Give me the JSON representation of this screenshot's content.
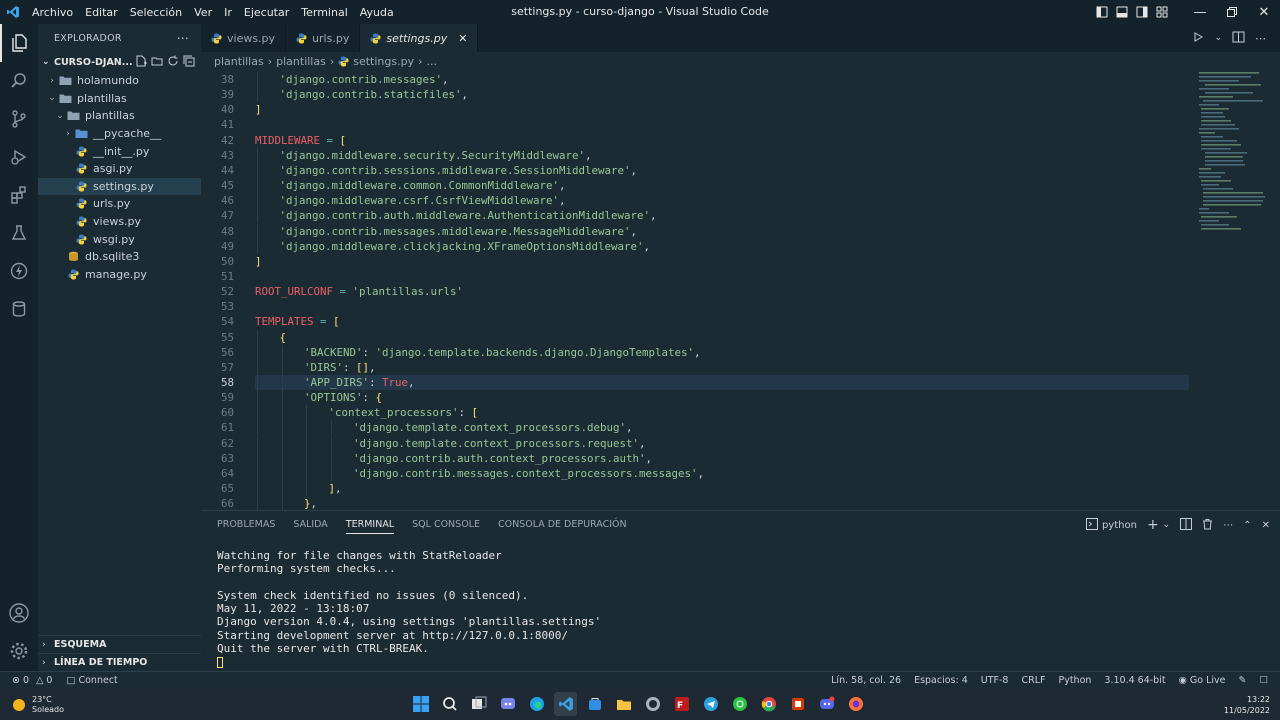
{
  "window": {
    "title": "settings.py - curso-django - Visual Studio Code",
    "menu": [
      "Archivo",
      "Editar",
      "Selección",
      "Ver",
      "Ir",
      "Ejecutar",
      "Terminal",
      "Ayuda"
    ]
  },
  "sidebar": {
    "header": "EXPLORADOR",
    "project": "CURSO-DJAN...",
    "tree": [
      {
        "label": "holamundo",
        "type": "folder",
        "depth": 1,
        "expanded": false
      },
      {
        "label": "plantillas",
        "type": "folder",
        "depth": 1,
        "expanded": true
      },
      {
        "label": "plantillas",
        "type": "folder",
        "depth": 2,
        "expanded": true
      },
      {
        "label": "__pycache__",
        "type": "folder",
        "depth": 3,
        "expanded": false
      },
      {
        "label": "__init__.py",
        "type": "py",
        "depth": 3
      },
      {
        "label": "asgi.py",
        "type": "py",
        "depth": 3
      },
      {
        "label": "settings.py",
        "type": "py",
        "depth": 3,
        "selected": true
      },
      {
        "label": "urls.py",
        "type": "py",
        "depth": 3
      },
      {
        "label": "views.py",
        "type": "py",
        "depth": 3
      },
      {
        "label": "wsgi.py",
        "type": "py",
        "depth": 3
      },
      {
        "label": "db.sqlite3",
        "type": "db",
        "depth": 2
      },
      {
        "label": "manage.py",
        "type": "py",
        "depth": 2
      }
    ],
    "outline": "ESQUEMA",
    "timeline": "LÍNEA DE TIEMPO"
  },
  "tabs": [
    {
      "label": "views.py",
      "active": false
    },
    {
      "label": "urls.py",
      "active": false
    },
    {
      "label": "settings.py",
      "active": true
    }
  ],
  "breadcrumb": [
    "plantillas",
    "plantillas",
    "settings.py",
    "..."
  ],
  "code": {
    "current_line": 58,
    "lines": [
      {
        "n": "38",
        "indent": 1,
        "tokens": [
          [
            "s",
            "'django.contrib.messages'"
          ],
          [
            "c",
            ","
          ]
        ]
      },
      {
        "n": "39",
        "indent": 1,
        "tokens": [
          [
            "s",
            "'django.contrib.staticfiles'"
          ],
          [
            "c",
            ","
          ]
        ]
      },
      {
        "n": "40",
        "indent": 0,
        "tokens": [
          [
            "p",
            "]"
          ]
        ]
      },
      {
        "n": "41",
        "indent": 0,
        "tokens": []
      },
      {
        "n": "42",
        "indent": 0,
        "tokens": [
          [
            "k",
            "MIDDLEWARE"
          ],
          [
            "o",
            " = "
          ],
          [
            "p",
            "["
          ]
        ]
      },
      {
        "n": "43",
        "indent": 1,
        "tokens": [
          [
            "s",
            "'django.middleware.security.SecurityMiddleware'"
          ],
          [
            "c",
            ","
          ]
        ]
      },
      {
        "n": "44",
        "indent": 1,
        "tokens": [
          [
            "s",
            "'django.contrib.sessions.middleware.SessionMiddleware'"
          ],
          [
            "c",
            ","
          ]
        ]
      },
      {
        "n": "45",
        "indent": 1,
        "tokens": [
          [
            "s",
            "'django.middleware.common.CommonMiddleware'"
          ],
          [
            "c",
            ","
          ]
        ]
      },
      {
        "n": "46",
        "indent": 1,
        "tokens": [
          [
            "s",
            "'django.middleware.csrf.CsrfViewMiddleware'"
          ],
          [
            "c",
            ","
          ]
        ]
      },
      {
        "n": "47",
        "indent": 1,
        "tokens": [
          [
            "s",
            "'django.contrib.auth.middleware.AuthenticationMiddleware'"
          ],
          [
            "c",
            ","
          ]
        ]
      },
      {
        "n": "48",
        "indent": 1,
        "tokens": [
          [
            "s",
            "'django.contrib.messages.middleware.MessageMiddleware'"
          ],
          [
            "c",
            ","
          ]
        ]
      },
      {
        "n": "49",
        "indent": 1,
        "tokens": [
          [
            "s",
            "'django.middleware.clickjacking.XFrameOptionsMiddleware'"
          ],
          [
            "c",
            ","
          ]
        ]
      },
      {
        "n": "50",
        "indent": 0,
        "tokens": [
          [
            "p",
            "]"
          ]
        ]
      },
      {
        "n": "51",
        "indent": 0,
        "tokens": []
      },
      {
        "n": "52",
        "indent": 0,
        "tokens": [
          [
            "k",
            "ROOT_URLCONF"
          ],
          [
            "o",
            " = "
          ],
          [
            "s",
            "'plantillas.urls'"
          ]
        ]
      },
      {
        "n": "53",
        "indent": 0,
        "tokens": []
      },
      {
        "n": "54",
        "indent": 0,
        "tokens": [
          [
            "k",
            "TEMPLATES"
          ],
          [
            "o",
            " = "
          ],
          [
            "p",
            "["
          ]
        ]
      },
      {
        "n": "55",
        "indent": 1,
        "tokens": [
          [
            "p",
            "{"
          ]
        ]
      },
      {
        "n": "56",
        "indent": 2,
        "tokens": [
          [
            "s",
            "'BACKEND'"
          ],
          [
            "c",
            ": "
          ],
          [
            "s",
            "'django.template.backends.django.DjangoTemplates'"
          ],
          [
            "c",
            ","
          ]
        ]
      },
      {
        "n": "57",
        "indent": 2,
        "tokens": [
          [
            "s",
            "'DIRS'"
          ],
          [
            "c",
            ": "
          ],
          [
            "p",
            "[]"
          ],
          [
            "c",
            ","
          ]
        ]
      },
      {
        "n": "58",
        "indent": 2,
        "tokens": [
          [
            "s",
            "'APP_DIRS'"
          ],
          [
            "c",
            ": "
          ],
          [
            "k",
            "True"
          ],
          [
            "c",
            ","
          ]
        ]
      },
      {
        "n": "59",
        "indent": 2,
        "tokens": [
          [
            "s",
            "'OPTIONS'"
          ],
          [
            "c",
            ": "
          ],
          [
            "p",
            "{"
          ]
        ]
      },
      {
        "n": "60",
        "indent": 3,
        "tokens": [
          [
            "s",
            "'context_processors'"
          ],
          [
            "c",
            ": "
          ],
          [
            "p",
            "["
          ]
        ]
      },
      {
        "n": "61",
        "indent": 4,
        "tokens": [
          [
            "s",
            "'django.template.context_processors.debug'"
          ],
          [
            "c",
            ","
          ]
        ]
      },
      {
        "n": "62",
        "indent": 4,
        "tokens": [
          [
            "s",
            "'django.template.context_processors.request'"
          ],
          [
            "c",
            ","
          ]
        ]
      },
      {
        "n": "63",
        "indent": 4,
        "tokens": [
          [
            "s",
            "'django.contrib.auth.context_processors.auth'"
          ],
          [
            "c",
            ","
          ]
        ]
      },
      {
        "n": "64",
        "indent": 4,
        "tokens": [
          [
            "s",
            "'django.contrib.messages.context_processors.messages'"
          ],
          [
            "c",
            ","
          ]
        ]
      },
      {
        "n": "65",
        "indent": 3,
        "tokens": [
          [
            "p",
            "]"
          ],
          [
            "c",
            ","
          ]
        ]
      },
      {
        "n": "66",
        "indent": 2,
        "tokens": [
          [
            "p",
            "}"
          ],
          [
            "c",
            ","
          ]
        ]
      }
    ]
  },
  "panel": {
    "tabs": [
      "PROBLEMAS",
      "SALIDA",
      "TERMINAL",
      "SQL CONSOLE",
      "CONSOLA DE DEPURACIÓN"
    ],
    "active_tab": "TERMINAL",
    "shell": "python",
    "terminal_lines": [
      "Watching for file changes with StatReloader",
      "Performing system checks...",
      "",
      "System check identified no issues (0 silenced).",
      "May 11, 2022 - 13:18:07",
      "Django version 4.0.4, using settings 'plantillas.settings'",
      "Starting development server at http://127.0.0.1:8000/",
      "Quit the server with CTRL-BREAK."
    ]
  },
  "statusbar": {
    "errors": "0",
    "warnings": "0",
    "connect": "Connect",
    "position": "Lín. 58, col. 26",
    "spaces": "Espacios: 4",
    "encoding": "UTF-8",
    "eol": "CRLF",
    "language": "Python",
    "interpreter": "3.10.4 64-bit",
    "golive": "Go Live"
  },
  "taskbar": {
    "temperature": "23°C",
    "weather": "Soleado",
    "time": "13:22",
    "date": "11/05/2022"
  },
  "colors": {
    "accent": "#e6e6e6",
    "string": "#99c794",
    "keyword": "#ec5f67",
    "bracket": "#ffe073"
  }
}
